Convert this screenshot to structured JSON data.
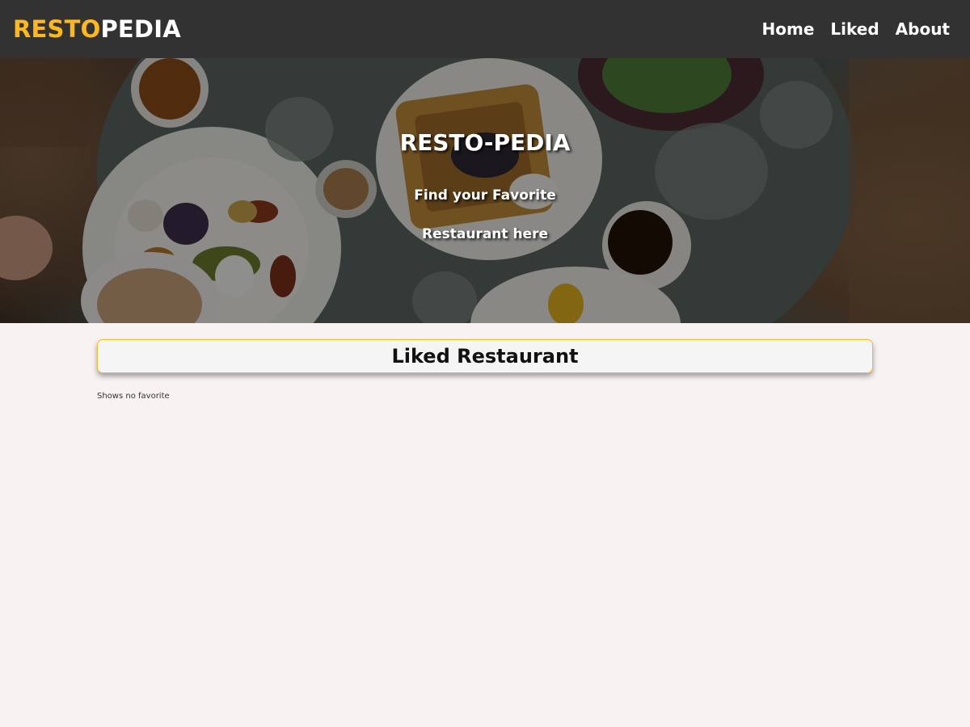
{
  "header": {
    "logo_accent": "RESTO",
    "logo_light": "PEDIA",
    "nav": [
      {
        "label": "Home"
      },
      {
        "label": "Liked"
      },
      {
        "label": "About"
      }
    ]
  },
  "hero": {
    "title": "RESTO-PEDIA",
    "tagline": "Find your Favorite Restaurant here"
  },
  "main": {
    "section_title": "Liked Restaurant",
    "empty_message": "Shows no favorite"
  },
  "colors": {
    "header_bg": "#323232",
    "brand_accent": "#ffb81c",
    "page_bg": "#f8f3f2"
  }
}
